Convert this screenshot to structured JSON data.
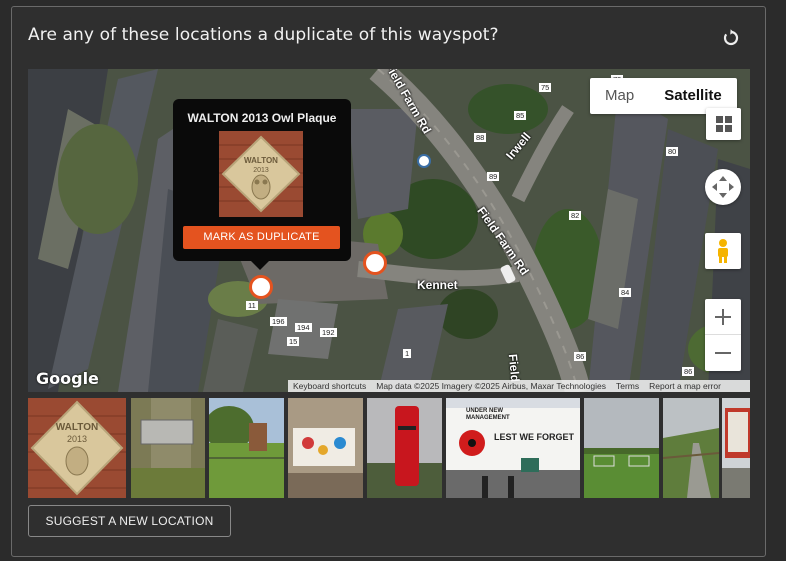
{
  "header": {
    "title": "Are any of these locations a duplicate of this wayspot?",
    "refresh_icon": "refresh-icon"
  },
  "map": {
    "map_type": {
      "map_label": "Map",
      "satellite_label": "Satellite",
      "selected": "Satellite"
    },
    "popup": {
      "title": "WALTON 2013 Owl Plaque",
      "button_label": "MARK AS DUPLICATE",
      "plaque_line1": "WALTON",
      "plaque_line2": "2013"
    },
    "street_labels": [
      "Field Farm Rd",
      "Irwell",
      "Field Farm Rd",
      "Kennet",
      "Field"
    ],
    "house_numbers": [
      "75",
      "79",
      "85",
      "88",
      "89",
      "80",
      "82",
      "84",
      "86",
      "11",
      "196",
      "194",
      "192",
      "15",
      "1",
      "86"
    ],
    "google_logo": "Google",
    "attribution": [
      "Keyboard shortcuts",
      "Map data ©2025 Imagery ©2025 Airbus, Maxar Technologies",
      "Terms",
      "Report a map error"
    ],
    "accent": "#e4531f"
  },
  "thumbnails": [
    {
      "name": "owl-plaque",
      "text1": "WALTON",
      "text2": "2013"
    },
    {
      "name": "tree-plaque"
    },
    {
      "name": "playground"
    },
    {
      "name": "painted-wall"
    },
    {
      "name": "post-box"
    },
    {
      "name": "memorial-wall",
      "text1": "UNDER NEW",
      "text2": "MANAGEMENT",
      "text3": "LEST WE FORGET"
    },
    {
      "name": "football-field"
    },
    {
      "name": "footpath"
    },
    {
      "name": "noticeboard"
    }
  ],
  "footer": {
    "suggest_label": "SUGGEST A NEW LOCATION"
  }
}
